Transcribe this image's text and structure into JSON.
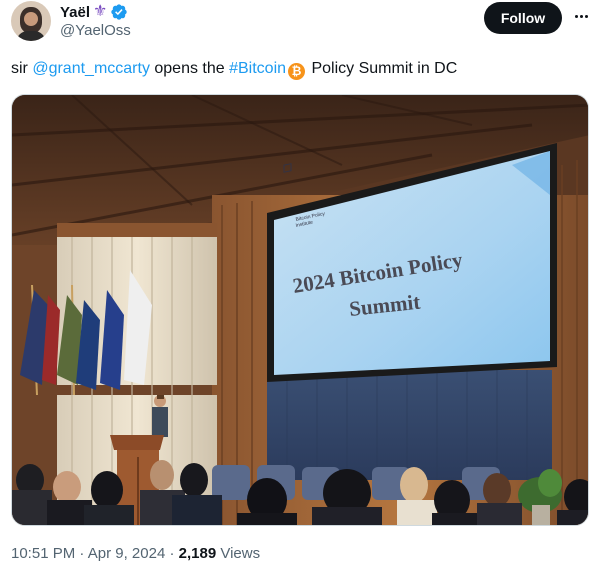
{
  "author": {
    "display_name": "Yaël",
    "handle": "@YaelOss",
    "badge_emoji": "⚜",
    "verified": true
  },
  "actions": {
    "follow_label": "Follow",
    "more_icon": "more-horizontal-icon"
  },
  "tweet": {
    "prefix": "sir ",
    "mention": "@grant_mccarty",
    "middle": " opens the ",
    "hashtag": "#Bitcoin",
    "btc_glyph": "₿",
    "suffix": " Policy Summit in DC"
  },
  "photo": {
    "screen_logo_line1": "Bitcoin Policy",
    "screen_logo_line2": "Institute",
    "screen_title_line1": "2024 Bitcoin Policy",
    "screen_title_line2": "Summit"
  },
  "meta": {
    "time": "10:51 PM",
    "separator": " · ",
    "date": "Apr 9, 2024",
    "views_count": "2,189",
    "views_label": " Views"
  },
  "colors": {
    "accent": "#1d9bf0",
    "text_primary": "#0f1419",
    "text_secondary": "#536471",
    "bitcoin": "#f7931a"
  }
}
